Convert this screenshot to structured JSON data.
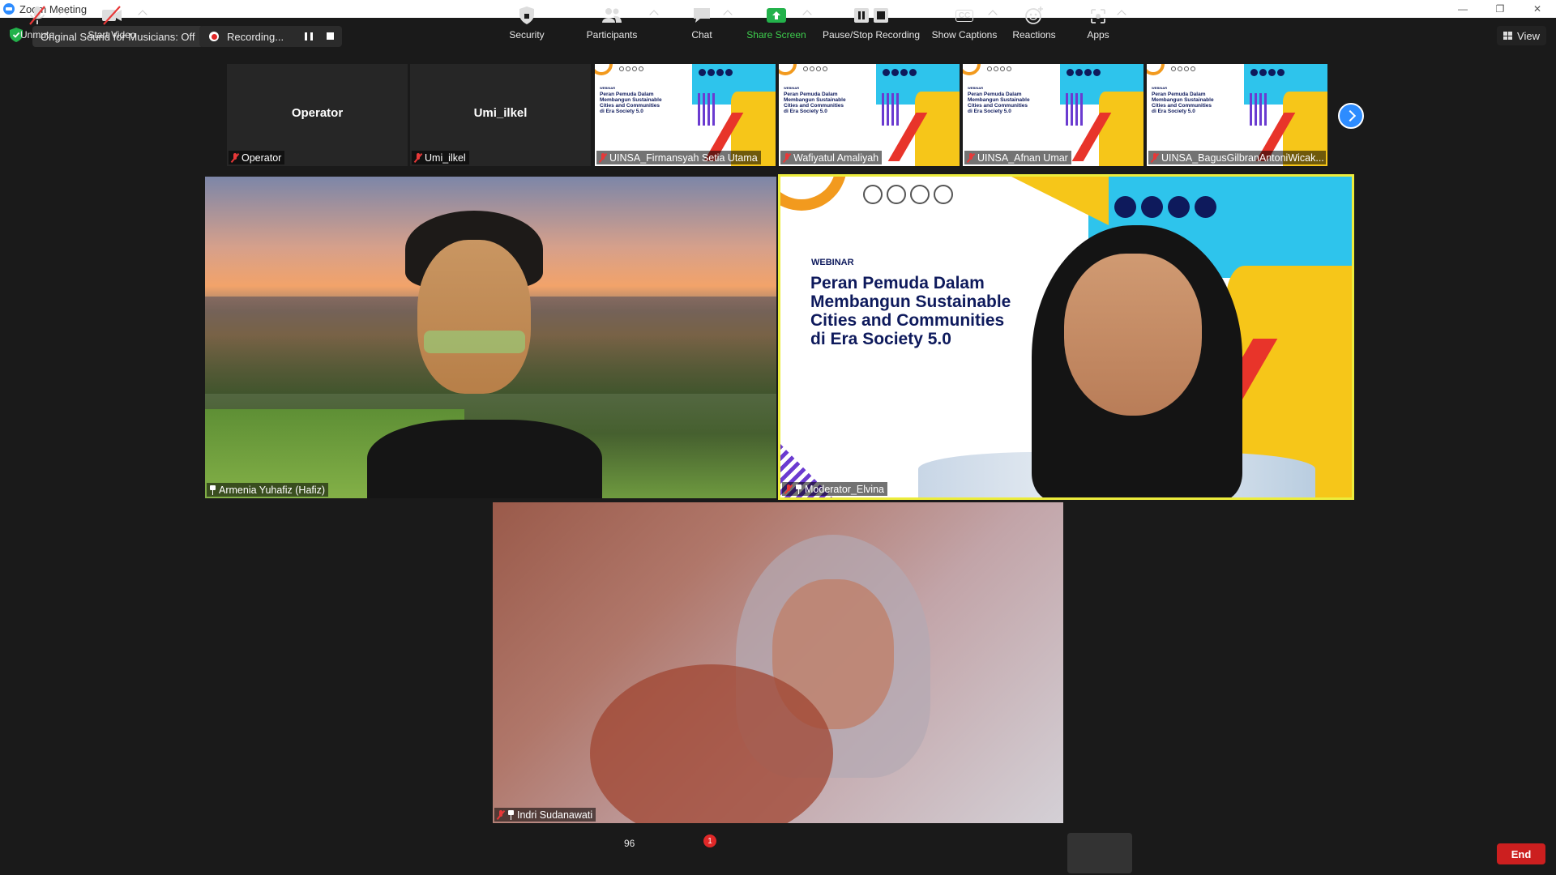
{
  "window": {
    "title": "Zoom Meeting",
    "controls": [
      "minimize",
      "restore",
      "close"
    ]
  },
  "topbar": {
    "original_sound": "Original Sound for Musicians: Off",
    "recording_status": "Recording...",
    "view_label": "View"
  },
  "thumbnails": [
    {
      "name": "Operator",
      "display_name": "Operator",
      "video": false,
      "muted": true
    },
    {
      "name": "Umi_ilkel",
      "display_name": "Umi_ilkel",
      "video": false,
      "muted": true
    },
    {
      "name": "UINSA_Firmansyah Setia Utama",
      "video": true,
      "muted": true
    },
    {
      "name": "Wafiyatul Amaliyah",
      "video": true,
      "muted": true
    },
    {
      "name": "UINSA_Afnan Umar",
      "video": true,
      "muted": true
    },
    {
      "name": "UINSA_BagusGilbranAntoniWicak...",
      "video": true,
      "muted": true
    }
  ],
  "slide": {
    "webinar": "WEBINAR",
    "title_lines": [
      "Peran Pemuda Dalam",
      "Membangun Sustainable",
      "Cities and Communities",
      "di Era Society 5.0"
    ]
  },
  "main_tiles": {
    "armenia": {
      "name": "Armenia Yuhafiz (Hafiz)",
      "pinned": true
    },
    "moderator": {
      "name": "Moderator_Elvina",
      "pinned": true,
      "muted": true,
      "active_speaker": true
    },
    "indri": {
      "name": "Indri Sudanawati",
      "pinned": true,
      "muted": true
    }
  },
  "toolbar": {
    "unmute": "Unmute",
    "start_video": "Start Video",
    "security": "Security",
    "participants": "Participants",
    "participants_count": "96",
    "chat": "Chat",
    "chat_badge": "1",
    "share_screen": "Share Screen",
    "pause_stop_recording": "Pause/Stop Recording",
    "show_captions": "Show Captions",
    "captions_icon_text": "CC",
    "reactions": "Reactions",
    "apps": "Apps",
    "end": "End"
  },
  "colors": {
    "zoom_blue": "#2d8cff",
    "active_speaker_border": "#ecec3c",
    "end_red": "#cc1f1f",
    "share_green": "#3ecf4e",
    "mute_red": "#e83838"
  }
}
